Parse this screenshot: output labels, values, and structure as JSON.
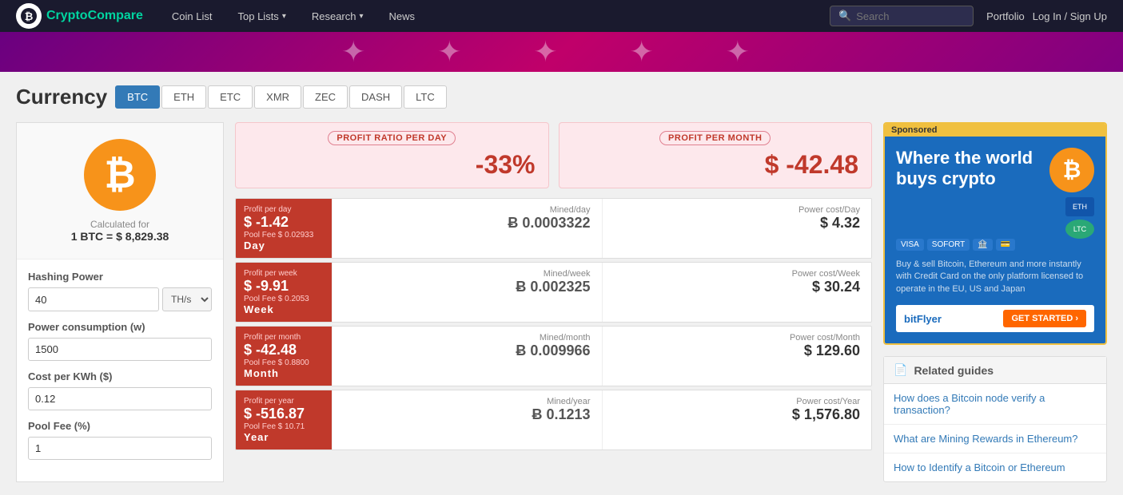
{
  "nav": {
    "logo_text1": "Crypto",
    "logo_text2": "Compare",
    "logo_icon": "₿",
    "items": [
      {
        "label": "Coin List",
        "has_arrow": false
      },
      {
        "label": "Top Lists",
        "has_arrow": true
      },
      {
        "label": "Research",
        "has_arrow": true
      },
      {
        "label": "News",
        "has_arrow": false
      }
    ],
    "search_placeholder": "Search",
    "portfolio_label": "Portfolio",
    "login_label": "Log In / Sign Up"
  },
  "page": {
    "title": "Currency",
    "tabs": [
      "BTC",
      "ETH",
      "ETC",
      "XMR",
      "ZEC",
      "DASH",
      "LTC"
    ],
    "active_tab": "BTC"
  },
  "btc_panel": {
    "icon": "₿",
    "calc_label": "Calculated for",
    "calc_value": "1 BTC = $ 8,829.38"
  },
  "form": {
    "hashing_power_label": "Hashing Power",
    "hashing_power_value": "40",
    "hashing_unit": "TH/s",
    "power_consumption_label": "Power consumption (w)",
    "power_consumption_value": "1500",
    "cost_per_kwh_label": "Cost per KWh ($)",
    "cost_per_kwh_value": "0.12",
    "pool_fee_label": "Pool Fee (%)",
    "pool_fee_value": "1"
  },
  "profit_cards": {
    "ratio_label": "PROFIT RATIO PER DAY",
    "ratio_value": "-33%",
    "month_label": "PROFIT PER MONTH",
    "month_value": "$ -42.48"
  },
  "data_rows": [
    {
      "period": "Day",
      "profit_sub": "Profit per day",
      "amount": "$ -1.42",
      "pool_fee": "Pool Fee $ 0.02933",
      "mined_label": "Mined/day",
      "mined_value": "Ƀ 0.0003322",
      "power_label": "Power cost/Day",
      "power_value": "$ 4.32"
    },
    {
      "period": "Week",
      "profit_sub": "Profit per week",
      "amount": "$ -9.91",
      "pool_fee": "Pool Fee $ 0.2053",
      "mined_label": "Mined/week",
      "mined_value": "Ƀ 0.002325",
      "power_label": "Power cost/Week",
      "power_value": "$ 30.24"
    },
    {
      "period": "Month",
      "profit_sub": "Profit per month",
      "amount": "$ -42.48",
      "pool_fee": "Pool Fee $ 0.8800",
      "mined_label": "Mined/month",
      "mined_value": "Ƀ 0.009966",
      "power_label": "Power cost/Month",
      "power_value": "$ 129.60"
    },
    {
      "period": "Year",
      "profit_sub": "Profit per year",
      "amount": "$ -516.87",
      "pool_fee": "Pool Fee $ 10.71",
      "mined_label": "Mined/year",
      "mined_value": "Ƀ 0.1213",
      "power_label": "Power cost/Year",
      "power_value": "$ 1,576.80"
    }
  ],
  "sponsored": {
    "tag": "Sponsored",
    "headline": "Where the world buys crypto",
    "btc_icon": "₿",
    "payments": [
      "VISA",
      "SOFORT",
      "🏦",
      "💳"
    ],
    "description": "Buy & sell Bitcoin, Ethereum and more instantly with Credit Card on the only platform licensed to operate in the EU, US and Japan",
    "logo": "bitFlyer",
    "cta": "GET STARTED ›"
  },
  "related_guides": {
    "header": "Related guides",
    "items": [
      "How does a Bitcoin node verify a transaction?",
      "What are Mining Rewards in Ethereum?",
      "How to Identify a Bitcoin or Ethereum"
    ]
  }
}
